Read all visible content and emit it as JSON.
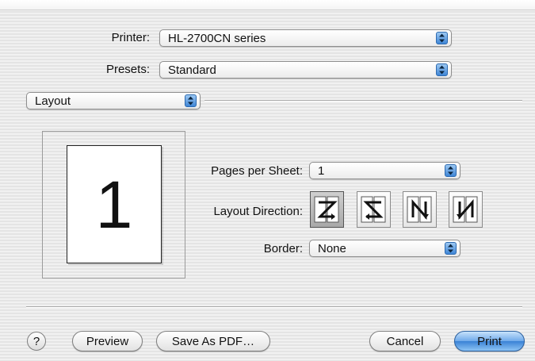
{
  "printer": {
    "label": "Printer:",
    "value": "HL-2700CN series"
  },
  "presets": {
    "label": "Presets:",
    "value": "Standard"
  },
  "panel": {
    "value": "Layout"
  },
  "preview": {
    "page_number": "1"
  },
  "layout": {
    "pages_per_sheet_label": "Pages per Sheet:",
    "pages_per_sheet_value": "1",
    "direction_label": "Layout Direction:",
    "direction_options": [
      "z-left-right",
      "z-right-left",
      "n-top-bottom-left",
      "n-top-bottom-right"
    ],
    "selected_direction": 0,
    "border_label": "Border:",
    "border_value": "None"
  },
  "buttons": {
    "help": "?",
    "preview": "Preview",
    "save_pdf": "Save As PDF…",
    "cancel": "Cancel",
    "print": "Print"
  },
  "colors": {
    "accent": "#3a82d6"
  }
}
